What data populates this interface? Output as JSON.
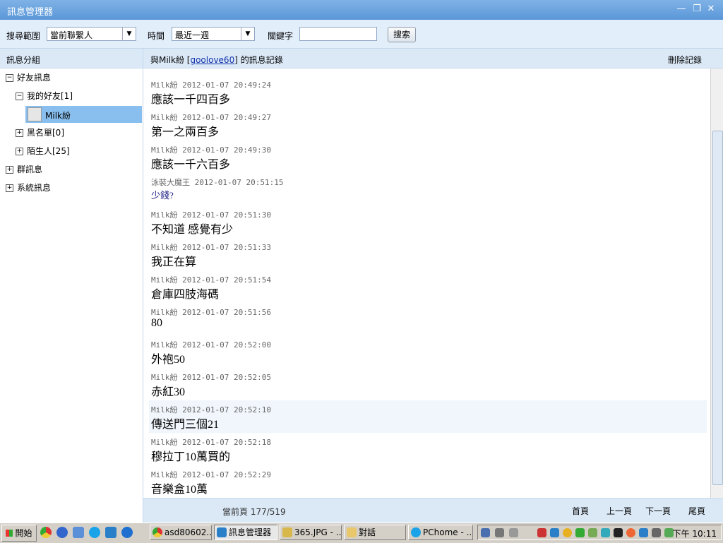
{
  "window": {
    "title": "訊息管理器"
  },
  "toolbar": {
    "scope_label": "搜尋範圍",
    "scope_value": "當前聯繫人",
    "time_label": "時間",
    "time_value": "最近一週",
    "keyword_label": "關鍵字",
    "keyword_value": "",
    "search_label": "搜索"
  },
  "left": {
    "header": "訊息分組",
    "tree": {
      "friends": "好友訊息",
      "my_friends": "我的好友[1]",
      "selected_friend": "Milk紛",
      "blacklist": "黑名單[0]",
      "strangers": "陌生人[25]",
      "groups": "群訊息",
      "system": "系統訊息"
    }
  },
  "main": {
    "header_prefix": "與Milk紛 [",
    "header_id": "goolove60",
    "header_suffix": "] 的訊息記錄",
    "delete_label": "刪除記錄",
    "messages": [
      {
        "meta": "Milk紛 2012-01-07 20:49:24",
        "text": "應該一千四百多"
      },
      {
        "meta": "Milk紛 2012-01-07 20:49:27",
        "text": "第一之兩百多"
      },
      {
        "meta": "Milk紛 2012-01-07 20:49:30",
        "text": "應該一千六百多"
      },
      {
        "meta": "泳裝大魔王 2012-01-07 20:51:15",
        "text": "少錢?"
      },
      {
        "meta": "Milk紛 2012-01-07 20:51:30",
        "text": "不知道 感覺有少"
      },
      {
        "meta": "Milk紛 2012-01-07 20:51:33",
        "text": "我正在算"
      },
      {
        "meta": "Milk紛 2012-01-07 20:51:54",
        "text": "倉庫四肢海碼"
      },
      {
        "meta": "Milk紛 2012-01-07 20:51:56",
        "text": "80"
      },
      {
        "meta": "Milk紛 2012-01-07 20:52:00",
        "text": "外袍50"
      },
      {
        "meta": "Milk紛 2012-01-07 20:52:05",
        "text": "赤紅30"
      },
      {
        "meta": "Milk紛 2012-01-07 20:52:10",
        "text": "傳送門三個21"
      },
      {
        "meta": "Milk紛 2012-01-07 20:52:18",
        "text": "穆拉丁10萬買的"
      },
      {
        "meta": "Milk紛 2012-01-07 20:52:29",
        "text": "音樂盒10萬"
      }
    ]
  },
  "footer": {
    "page_info": "當前頁 177/519",
    "first": "首頁",
    "prev": "上一頁",
    "next": "下一頁",
    "last": "尾頁"
  },
  "taskbar": {
    "start": "開始",
    "tasks": [
      "asd80602...",
      "訊息管理器",
      "365.JPG - ...",
      "對話",
      "PChome - ..."
    ],
    "clock": "下午 10:11"
  }
}
